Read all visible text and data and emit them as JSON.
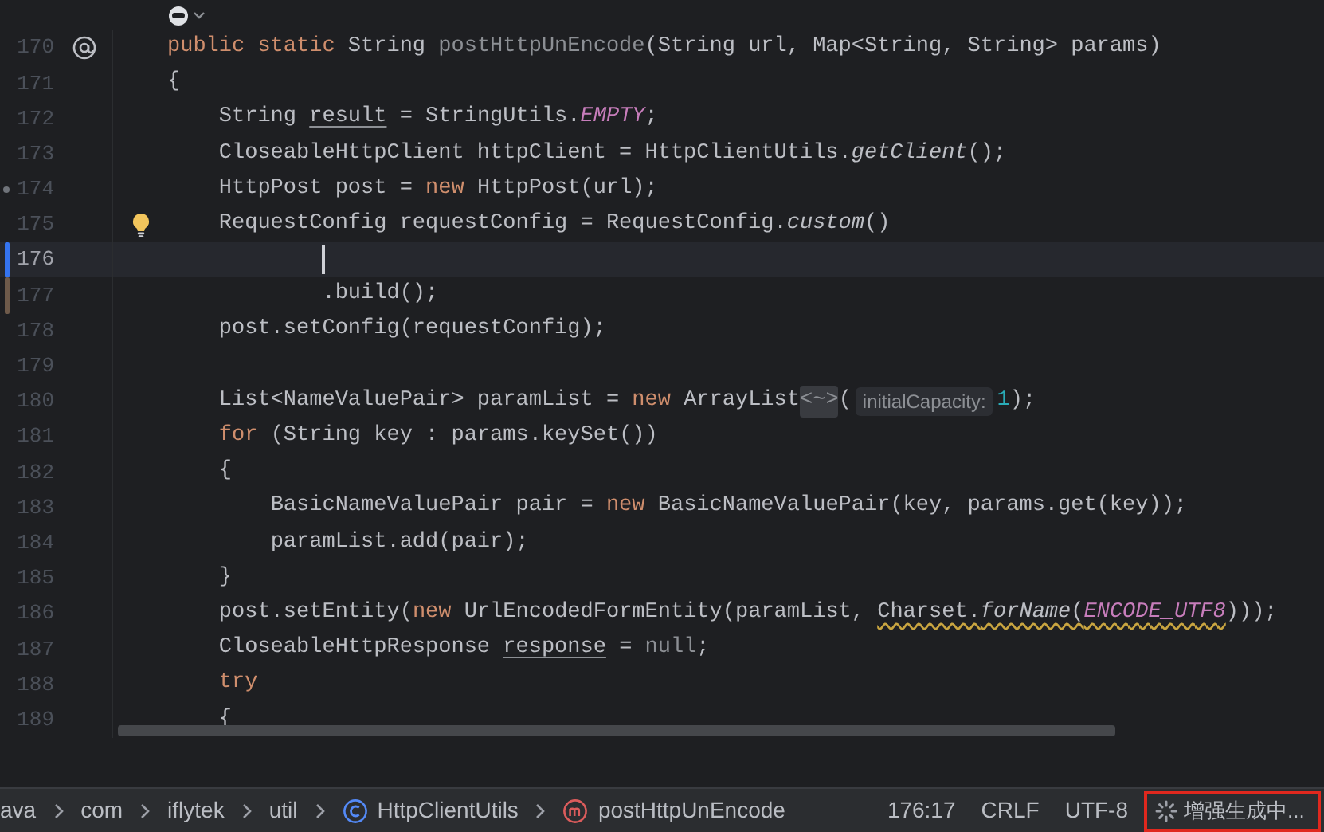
{
  "editor": {
    "lines": [
      {
        "number": "170",
        "gutter": {
          "kind": "at"
        },
        "tokens": [
          {
            "text": "public static ",
            "kind": "keyword"
          },
          {
            "text": "String ",
            "kind": "plain"
          },
          {
            "text": "postHttpUnEncode",
            "kind": "muted"
          },
          {
            "text": "(String url, Map<String, String> params)",
            "kind": "plain"
          }
        ]
      },
      {
        "number": "171",
        "tokens": [
          {
            "text": "{",
            "kind": "plain"
          }
        ]
      },
      {
        "number": "172",
        "tokens": [
          {
            "text": "    String ",
            "kind": "plain"
          },
          {
            "text": "result",
            "kind": "underline"
          },
          {
            "text": " = StringUtils.",
            "kind": "plain"
          },
          {
            "text": "EMPTY",
            "kind": "field"
          },
          {
            "text": ";",
            "kind": "plain"
          }
        ]
      },
      {
        "number": "173",
        "tokens": [
          {
            "text": "    CloseableHttpClient httpClient = HttpClientUtils.",
            "kind": "plain"
          },
          {
            "text": "getClient",
            "kind": "italic"
          },
          {
            "text": "();",
            "kind": "plain"
          }
        ]
      },
      {
        "number": "174",
        "gutter": {
          "kind": "dot"
        },
        "tokens": [
          {
            "text": "    HttpPost post = ",
            "kind": "plain"
          },
          {
            "text": "new",
            "kind": "keyword"
          },
          {
            "text": " HttpPost(url);",
            "kind": "plain"
          }
        ]
      },
      {
        "number": "175",
        "gutter": {
          "kind": "bulb"
        },
        "tokens": [
          {
            "text": "    RequestConfig requestConfig = RequestConfig.",
            "kind": "plain"
          },
          {
            "text": "custom",
            "kind": "italic"
          },
          {
            "text": "()",
            "kind": "plain"
          }
        ]
      },
      {
        "number": "176",
        "current": true,
        "cursor": true,
        "change_marker": {
          "color": "#3574f0"
        }
      },
      {
        "number": "177",
        "change_marker": {
          "color": "#6e5a4a"
        },
        "tokens": [
          {
            "text": "            .build();",
            "kind": "plain"
          }
        ]
      },
      {
        "number": "178",
        "tokens": [
          {
            "text": "    post.setConfig(requestConfig);",
            "kind": "plain"
          }
        ]
      },
      {
        "number": "179"
      },
      {
        "number": "180",
        "tokens": [
          {
            "text": "    List<NameValuePair> paramList = ",
            "kind": "plain"
          },
          {
            "text": "new",
            "kind": "keyword"
          },
          {
            "text": " ArrayList",
            "kind": "plain"
          },
          {
            "text": "<~>",
            "kind": "folded"
          },
          {
            "text": "(",
            "kind": "plain"
          },
          {
            "text": "initialCapacity:",
            "kind": "hint"
          },
          {
            "text": "1",
            "kind": "number"
          },
          {
            "text": ");",
            "kind": "plain"
          }
        ]
      },
      {
        "number": "181",
        "tokens": [
          {
            "text": "    for",
            "kind": "keyword"
          },
          {
            "text": " (String key : params.keySet())",
            "kind": "plain"
          }
        ]
      },
      {
        "number": "182",
        "tokens": [
          {
            "text": "    {",
            "kind": "plain"
          }
        ]
      },
      {
        "number": "183",
        "tokens": [
          {
            "text": "        BasicNameValuePair pair = ",
            "kind": "plain"
          },
          {
            "text": "new",
            "kind": "keyword"
          },
          {
            "text": " BasicNameValuePair(key, params.get(key));",
            "kind": "plain"
          }
        ]
      },
      {
        "number": "184",
        "tokens": [
          {
            "text": "        paramList.add(pair);",
            "kind": "plain"
          }
        ]
      },
      {
        "number": "185",
        "tokens": [
          {
            "text": "    }",
            "kind": "plain"
          }
        ]
      },
      {
        "number": "186",
        "tokens": [
          {
            "text": "    post.setEntity(",
            "kind": "plain"
          },
          {
            "text": "new",
            "kind": "keyword"
          },
          {
            "text": " UrlEncodedFormEntity(paramList, ",
            "kind": "plain"
          },
          {
            "text": "Charset.",
            "kind": "warn"
          },
          {
            "text": "forName",
            "kind": "warn-italic"
          },
          {
            "text": "(",
            "kind": "warn"
          },
          {
            "text": "ENCODE_UTF8",
            "kind": "warn-field"
          },
          {
            "text": ")));",
            "kind": "plain"
          }
        ]
      },
      {
        "number": "187",
        "tokens": [
          {
            "text": "    CloseableHttpResponse ",
            "kind": "plain"
          },
          {
            "text": "response",
            "kind": "underline"
          },
          {
            "text": " = ",
            "kind": "plain"
          },
          {
            "text": "null",
            "kind": "muted"
          },
          {
            "text": ";",
            "kind": "plain"
          }
        ]
      },
      {
        "number": "188",
        "tokens": [
          {
            "text": "    try",
            "kind": "keyword"
          }
        ]
      },
      {
        "number": "189",
        "tokens": [
          {
            "text": "    {",
            "kind": "plain"
          }
        ]
      }
    ]
  },
  "status_bar": {
    "breadcrumbs": [
      {
        "label": "ava",
        "kind": "package"
      },
      {
        "label": "com",
        "kind": "package"
      },
      {
        "label": "iflytek",
        "kind": "package"
      },
      {
        "label": "util",
        "kind": "package"
      },
      {
        "label": "HttpClientUtils",
        "kind": "class"
      },
      {
        "label": "postHttpUnEncode",
        "kind": "method"
      }
    ],
    "position": "176:17",
    "line_separator": "CRLF",
    "encoding": "UTF-8",
    "task": {
      "label": "增强生成中...",
      "outlined": true
    }
  }
}
